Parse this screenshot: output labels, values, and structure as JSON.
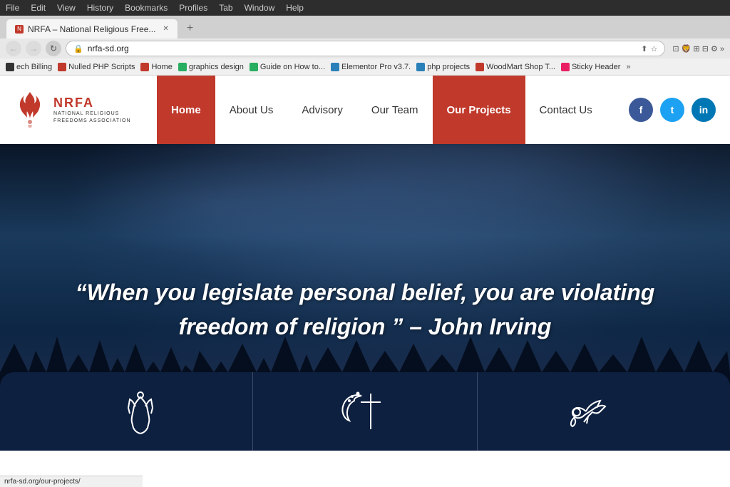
{
  "browser": {
    "menu_items": [
      "File",
      "Edit",
      "View",
      "History",
      "Bookmarks",
      "Profiles",
      "Tab",
      "Window",
      "Help"
    ],
    "tab_title": "NRFA – National Religious Free...",
    "url": "nrfa-sd.org",
    "new_tab_label": "+",
    "bookmarks": [
      {
        "label": "ech Billing",
        "color": "red"
      },
      {
        "label": "Nulled PHP Scripts",
        "color": "red"
      },
      {
        "label": "Home",
        "color": "red"
      },
      {
        "label": "graphics design",
        "color": "green"
      },
      {
        "label": "Guide on How to...",
        "color": "green"
      },
      {
        "label": "Elementor Pro v3.7.",
        "color": "blue"
      },
      {
        "label": "php projects",
        "color": "blue"
      },
      {
        "label": "WoodMart Shop T...",
        "color": "red"
      },
      {
        "label": "Sticky Header",
        "color": "pink"
      }
    ],
    "status_url": "nrfa-sd.org/our-projects/"
  },
  "website": {
    "logo": {
      "nrfa_text": "NRFA",
      "subtitle_line1": "NATIONAL RELIGIOUS",
      "subtitle_line2": "FREEDOMS ASSOCIATION"
    },
    "nav": {
      "items": [
        {
          "label": "Home",
          "active": true,
          "highlight": "red"
        },
        {
          "label": "About Us",
          "active": false
        },
        {
          "label": "Advisory",
          "active": false
        },
        {
          "label": "Our Team",
          "active": false
        },
        {
          "label": "Our Projects",
          "active": true,
          "highlight": "red"
        },
        {
          "label": "Contact Us",
          "active": false
        }
      ]
    },
    "social": {
      "facebook_label": "f",
      "twitter_label": "t",
      "linkedin_label": "in"
    },
    "hero": {
      "quote": "“When you legislate personal belief, you are violating freedom of religion ” – John Irving"
    },
    "bottom_icons": [
      {
        "symbol": "🙏"
      },
      {
        "symbol": "✝"
      },
      {
        "symbol": "🕊"
      }
    ]
  }
}
